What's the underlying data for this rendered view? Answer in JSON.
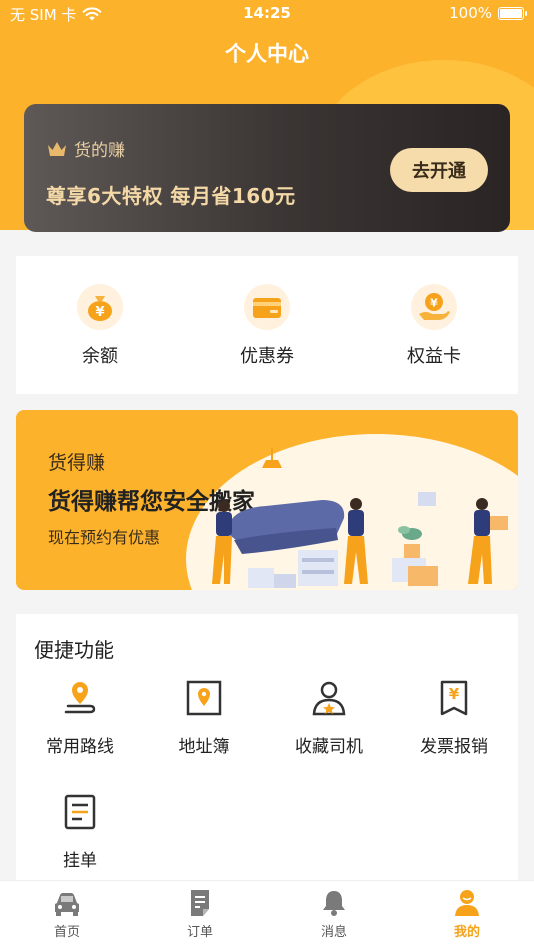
{
  "status_bar": {
    "carrier": "无 SIM 卡",
    "time": "14:25",
    "battery": "100%"
  },
  "header": {
    "title": "个人中心"
  },
  "vip_card": {
    "brand": "货的赚",
    "slogan": "尊享6大特权 每月省160元",
    "button_label": "去开通"
  },
  "wallet": {
    "items": [
      {
        "label": "余额",
        "icon": "money-bag-icon"
      },
      {
        "label": "优惠券",
        "icon": "coupon-icon"
      },
      {
        "label": "权益卡",
        "icon": "hand-coin-icon"
      }
    ]
  },
  "banner": {
    "kicker": "货得赚",
    "headline": "货得赚帮您安全搬家",
    "subtitle": "现在预约有优惠"
  },
  "shortcuts": {
    "title": "便捷功能",
    "items": [
      {
        "label": "常用路线",
        "icon": "route-icon"
      },
      {
        "label": "地址簿",
        "icon": "address-book-icon"
      },
      {
        "label": "收藏司机",
        "icon": "favorite-driver-icon"
      },
      {
        "label": "发票报销",
        "icon": "invoice-icon"
      },
      {
        "label": "挂单",
        "icon": "pending-order-icon"
      }
    ]
  },
  "tabbar": {
    "items": [
      {
        "label": "首页",
        "icon": "car-icon"
      },
      {
        "label": "订单",
        "icon": "order-icon"
      },
      {
        "label": "消息",
        "icon": "bell-icon"
      },
      {
        "label": "我的",
        "icon": "user-icon"
      }
    ],
    "active": "我的"
  },
  "colors": {
    "accent": "#fdb22c",
    "accent_dark": "#f4a31d",
    "vip_gold": "#f4d9a7"
  }
}
